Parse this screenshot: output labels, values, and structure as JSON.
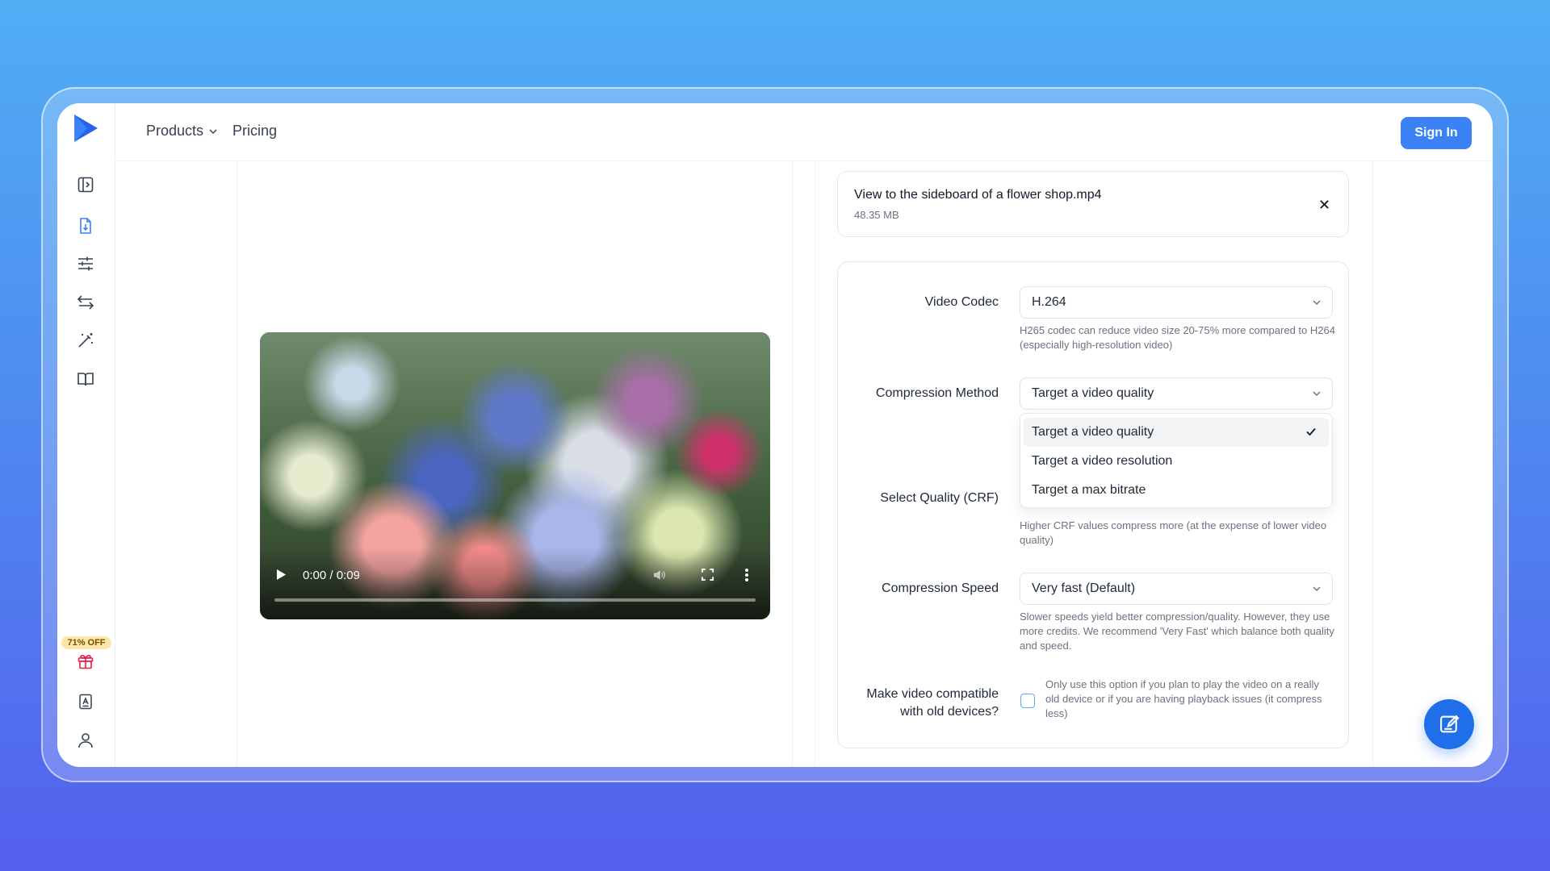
{
  "header": {
    "nav": {
      "products_label": "Products",
      "pricing_label": "Pricing"
    },
    "signin_label": "Sign In"
  },
  "sidebar": {
    "icons": [
      "sidebar-toggle-icon",
      "file-compress-icon",
      "sliders-icon",
      "swap-icon",
      "magic-wand-icon",
      "book-icon",
      "gift-icon",
      "document-icon",
      "user-icon"
    ],
    "promo_badge": "71% OFF"
  },
  "video": {
    "time": "0:00 / 0:09",
    "progress": 0
  },
  "file": {
    "name": "View to the sideboard of a flower shop.mp4",
    "size": "48.35 MB"
  },
  "settings": {
    "codec": {
      "label": "Video Codec",
      "value": "H.264",
      "help": "H265 codec can reduce video size 20-75% more compared to H264 (especially high-resolution video)"
    },
    "method": {
      "label": "Compression Method",
      "value": "Target a video quality",
      "options": [
        "Target a video quality",
        "Target a video resolution",
        "Target a max bitrate"
      ],
      "selected_index": 0
    },
    "quality": {
      "label": "Select Quality (CRF)",
      "help": "Higher CRF values compress more (at the expense of lower video quality)"
    },
    "speed": {
      "label": "Compression Speed",
      "value": "Very fast (Default)",
      "help": "Slower speeds yield better compression/quality. However, they use more credits. We recommend 'Very Fast' which balance both quality and speed."
    },
    "compat": {
      "label_line1": "Make video compatible",
      "label_line2": "with old devices?",
      "help": "Only use this option if you plan to play the video on a really old device or if you are having playback issues (it compress less)",
      "checked": false
    }
  },
  "colors": {
    "accent": "#3b82f6",
    "fab": "#1f6feb",
    "badge_bg": "#fde7a8"
  }
}
